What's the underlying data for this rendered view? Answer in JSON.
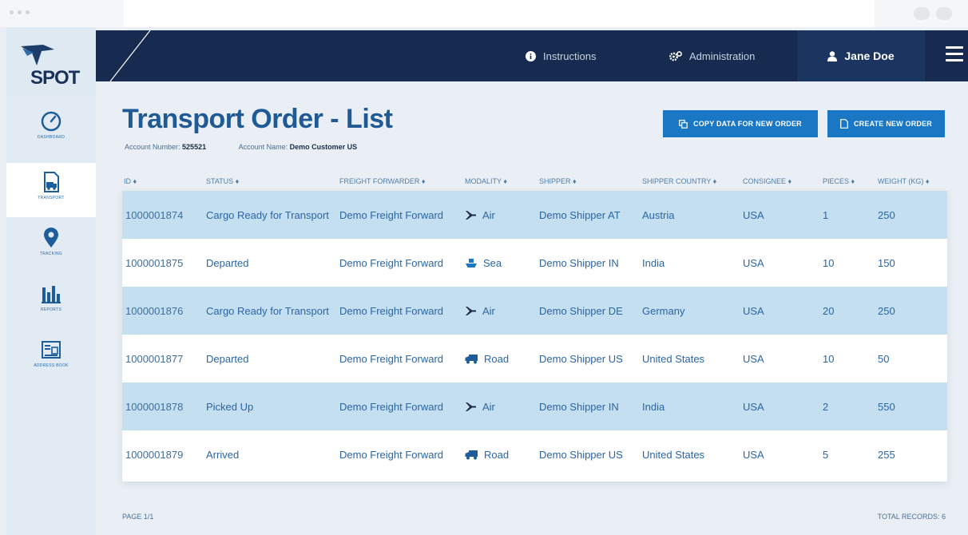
{
  "app": {
    "logo_text": "SPOT"
  },
  "sidebar": {
    "items": [
      {
        "label": "DASHBOARD",
        "icon": "dashboard-gauge-icon",
        "active": false
      },
      {
        "label": "TRANSPORT",
        "icon": "truck-document-icon",
        "active": true
      },
      {
        "label": "TRACKING",
        "icon": "map-pin-icon",
        "active": false
      },
      {
        "label": "REPORTS",
        "icon": "bar-chart-icon",
        "active": false
      },
      {
        "label": "ADDRESS BOOK",
        "icon": "address-card-icon",
        "active": false
      }
    ]
  },
  "header": {
    "instructions_label": "Instructions",
    "administration_label": "Administration",
    "user_name": "Jane Doe"
  },
  "page": {
    "title": "Transport Order - List",
    "account_number_label": "Account Number:",
    "account_number": "525521",
    "account_name_label": "Account Name:",
    "account_name": "Demo Customer US",
    "copy_button_label": "COPY DATA FOR NEW ORDER",
    "create_button_label": "CREATE NEW ORDER"
  },
  "table": {
    "columns": [
      "ID ♦",
      "STATUS ♦",
      "FREIGHT FORWARDER ♦",
      "MODALITY ♦",
      "SHIPPER ♦",
      "SHIPPER COUNTRY ♦",
      "CONSIGNEE ♦",
      "PIECES ♦",
      "WEIGHT (KG) ♦"
    ],
    "rows": [
      {
        "id": "1000001874",
        "status": "Cargo Ready for Transport",
        "forwarder": "Demo Freight Forward",
        "modality": "Air",
        "modality_icon": "airplane-icon",
        "shipper": "Demo Shipper AT",
        "country": "Austria",
        "consignee": "USA",
        "pieces": "1",
        "weight": "250"
      },
      {
        "id": "1000001875",
        "status": "Departed",
        "forwarder": "Demo Freight Forward",
        "modality": "Sea",
        "modality_icon": "ship-icon",
        "shipper": "Demo Shipper IN",
        "country": "India",
        "consignee": "USA",
        "pieces": "10",
        "weight": "150"
      },
      {
        "id": "1000001876",
        "status": "Cargo Ready for Transport",
        "forwarder": "Demo Freight Forward",
        "modality": "Air",
        "modality_icon": "airplane-icon",
        "shipper": "Demo Shipper DE",
        "country": "Germany",
        "consignee": "USA",
        "pieces": "20",
        "weight": "250"
      },
      {
        "id": "1000001877",
        "status": "Departed",
        "forwarder": "Demo Freight Forward",
        "modality": "Road",
        "modality_icon": "truck-icon",
        "shipper": "Demo Shipper US",
        "country": "United States",
        "consignee": "USA",
        "pieces": "10",
        "weight": "50"
      },
      {
        "id": "1000001878",
        "status": "Picked Up",
        "forwarder": "Demo Freight Forward",
        "modality": "Air",
        "modality_icon": "airplane-icon",
        "shipper": "Demo Shipper IN",
        "country": "India",
        "consignee": "USA",
        "pieces": "2",
        "weight": "550"
      },
      {
        "id": "1000001879",
        "status": "Arrived",
        "forwarder": "Demo Freight Forward",
        "modality": "Road",
        "modality_icon": "truck-icon",
        "shipper": "Demo Shipper US",
        "country": "United States",
        "consignee": "USA",
        "pieces": "5",
        "weight": "255"
      }
    ]
  },
  "footer": {
    "page_label": "PAGE 1/1",
    "total_records_label": "TOTAL RECORDS: 6"
  },
  "colors": {
    "navy": "#162b4f",
    "accent_blue": "#1a77c4",
    "row_highlight": "#c4dff0",
    "text_blue": "#2a65a4"
  }
}
